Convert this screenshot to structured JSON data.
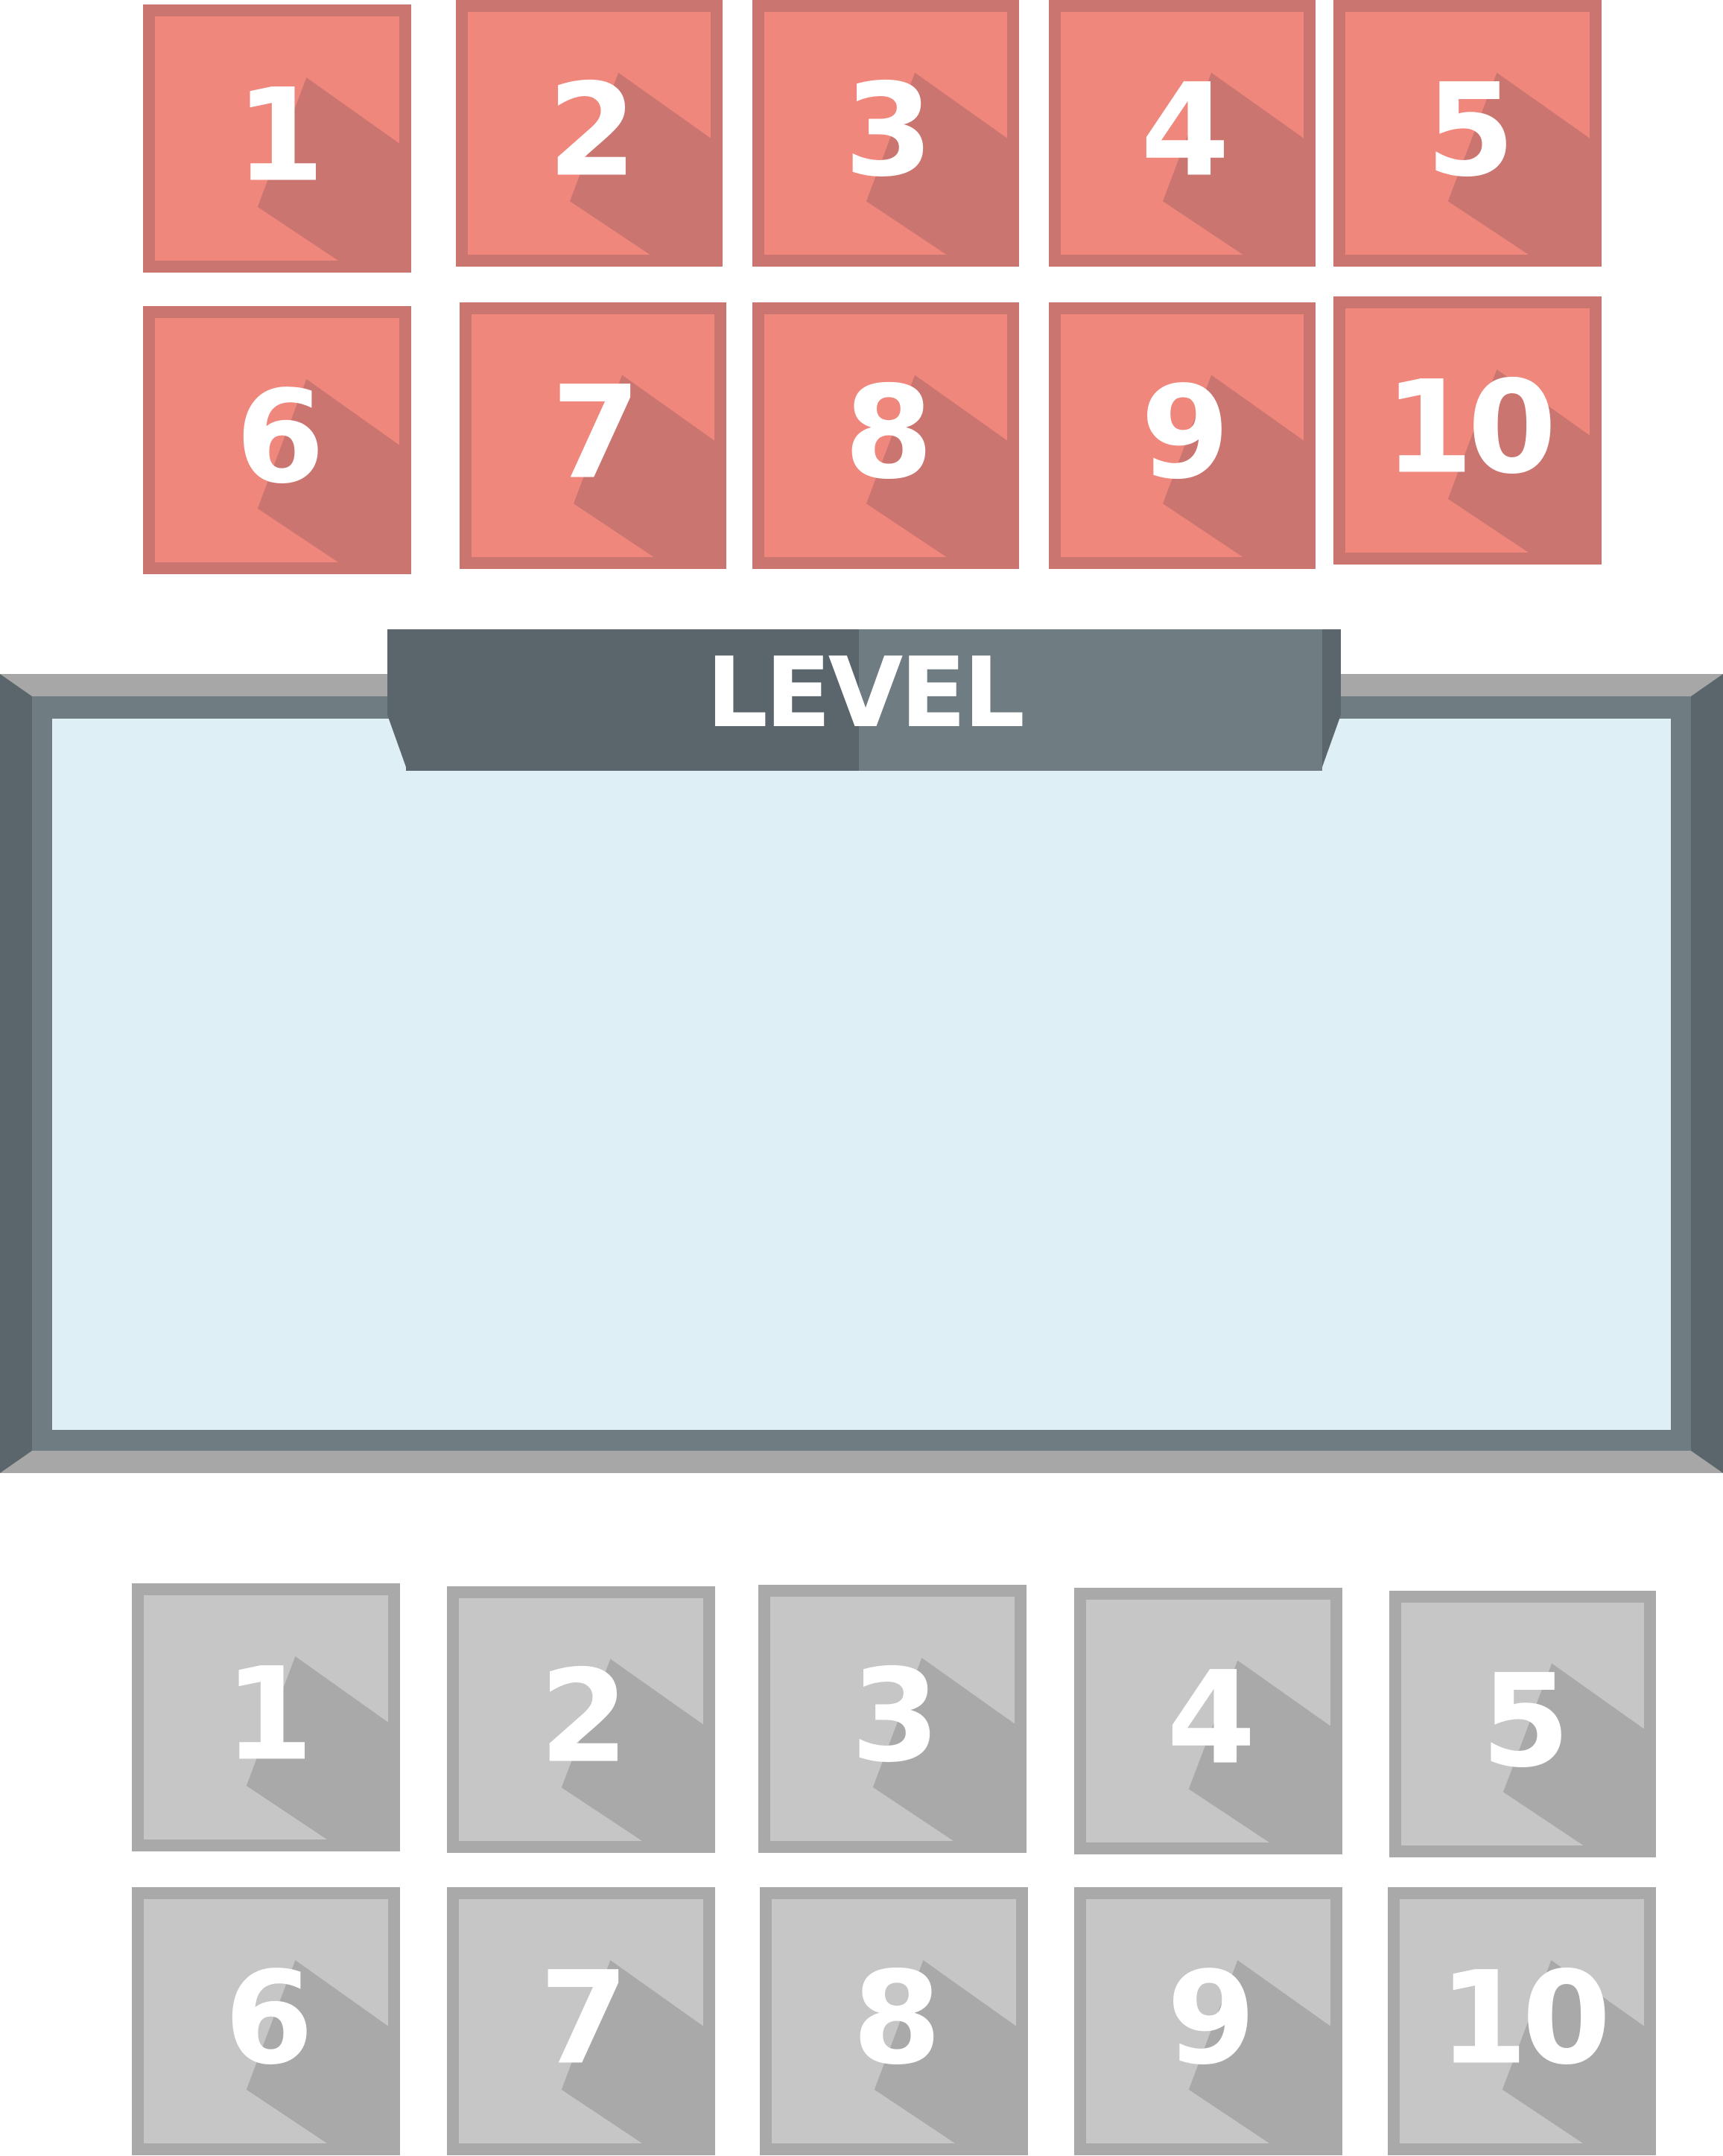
{
  "level_panel": {
    "title": "LEVEL"
  },
  "unlocked_levels": [
    {
      "label": "1"
    },
    {
      "label": "2"
    },
    {
      "label": "3"
    },
    {
      "label": "4"
    },
    {
      "label": "5"
    },
    {
      "label": "6"
    },
    {
      "label": "7"
    },
    {
      "label": "8"
    },
    {
      "label": "9"
    },
    {
      "label": "10"
    }
  ],
  "locked_levels": [
    {
      "label": "1"
    },
    {
      "label": "2"
    },
    {
      "label": "3"
    },
    {
      "label": "4"
    },
    {
      "label": "5"
    },
    {
      "label": "6"
    },
    {
      "label": "7"
    },
    {
      "label": "8"
    },
    {
      "label": "9"
    },
    {
      "label": "10"
    }
  ],
  "colors": {
    "unlocked_tile": "#f0877c",
    "unlocked_tile_border": "#cb7571",
    "locked_tile": "#c6c6c6",
    "locked_tile_border": "#a9a9a9",
    "panel_frame": "#6f7d82",
    "panel_inner": "#dfeff6",
    "number_text": "#ffffff"
  }
}
